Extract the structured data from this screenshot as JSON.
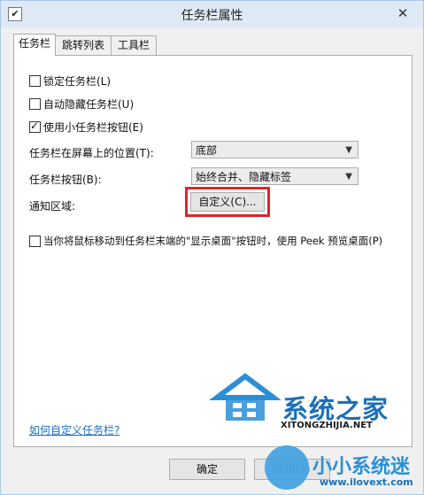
{
  "window": {
    "title": "任务栏属性",
    "close_glyph": "✕",
    "app_icon_glyph": "✔"
  },
  "tabs": [
    "任务栏",
    "跳转列表",
    "工具栏"
  ],
  "checkboxes": [
    {
      "label": "锁定任务栏(L)",
      "checked": false
    },
    {
      "label": "自动隐藏任务栏(U)",
      "checked": false
    },
    {
      "label": "使用小任务栏按钮(E)",
      "checked": true
    }
  ],
  "position": {
    "label": "任务栏在屏幕上的位置(T):",
    "value": "底部"
  },
  "buttons_setting": {
    "label": "任务栏按钮(B):",
    "value": "始终合并、隐藏标签"
  },
  "notification": {
    "label": "通知区域:",
    "button": "自定义(C)..."
  },
  "peek": {
    "label": "当你将鼠标移动到任务栏末端的\"显示桌面\"按钮时，使用 Peek 预览桌面(P)",
    "checked": false
  },
  "help_link": "如何自定义任务栏?",
  "footer": {
    "ok": "确定",
    "apply": "应用(A)"
  },
  "watermark": {
    "brand1": "系统之家",
    "brand1_url": "XITONGZHIJIA.NET",
    "brand2": "小小系统迷",
    "brand2_url": "www.ilovext.com"
  },
  "colors": {
    "highlight_border": "#d9262c",
    "link": "#1a6ec4",
    "watermark_blue": "#2a8fd6"
  }
}
